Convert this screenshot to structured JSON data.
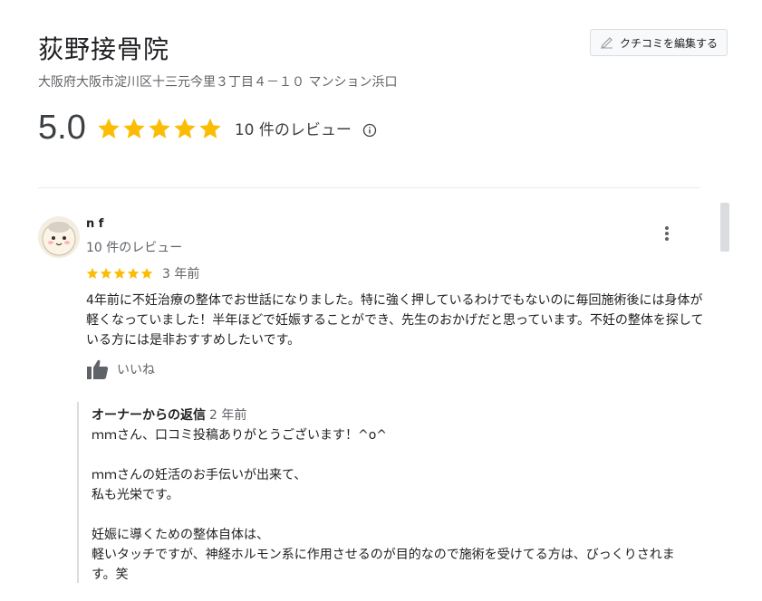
{
  "business": {
    "name": "荻野接骨院",
    "address": "大阪府大阪市淀川区十三元今里３丁目４－１０ マンション浜口",
    "write_review_label": "クチコミを編集する",
    "rating": "5.0",
    "stars": 5,
    "review_count_label": "10 件のレビュー"
  },
  "colors": {
    "star": "#fbbc04",
    "text": "#202124",
    "secondary": "#5f6368"
  },
  "review": {
    "author": "n f",
    "author_reviews": "10 件のレビュー",
    "stars": 5,
    "date": "3 年前",
    "text": "4年前に不妊治療の整体でお世話になりました。特に強く押しているわけでもないのに毎回施術後には身体が軽くなっていました！半年ほどで妊娠することができ、先生のおかげだと思っています。不妊の整体を探している方には是非おすすめしたいです。",
    "like_label": "いいね"
  },
  "owner_reply": {
    "title": "オーナーからの返信",
    "date": "2 年前",
    "text": "ｍｍさん、口コミ投稿ありがとうございます！^o^\n\nｍｍさんの妊活のお手伝いが出来て、\n私も光栄です。\n\n妊娠に導くための整体自体は、\n軽いタッチですが、神経ホルモン系に作用させるのが目的なので施術を受けてる方は、びっくりされます。笑"
  }
}
